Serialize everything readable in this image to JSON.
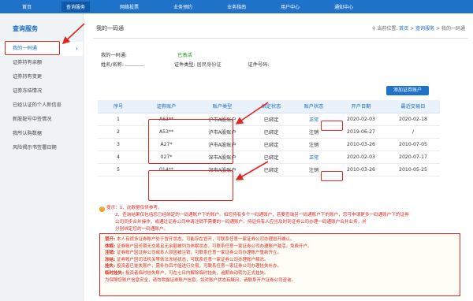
{
  "topnav": {
    "items": [
      "首页",
      "查询服务",
      "网络投票",
      "业务预约",
      "业务指南",
      "用户中心",
      "通知中心"
    ]
  },
  "sidebar": {
    "title": "查询服务",
    "items": [
      "我的一码通",
      "证券持有余额",
      "证券持有变更",
      "证券冻结情况",
      "已经认证的个人新信息",
      "新股配号中签情况",
      "我所认购数据",
      "风险揭示书签署日期"
    ],
    "chevron": "›"
  },
  "header": {
    "title": "我的一码通",
    "breadcrumb_prefix": "当前位置:",
    "breadcrumb": [
      "首页",
      "查询服务",
      "我的一码通"
    ]
  },
  "info": {
    "account_label": "我的一码通:",
    "status": "已激活",
    "name_label": "姓名/名称:",
    "id_type_label": "证件类型:",
    "id_type_value": "居民身份证",
    "id_no_label": "证件号码:"
  },
  "add_button": "添加证券账户",
  "table": {
    "headers": [
      "序号",
      "证券账户",
      "账户类型",
      "绑定状态",
      "账户状态",
      "开户日期",
      "最近交易日"
    ],
    "rows": [
      [
        "1",
        "A63**",
        "沪市A股账户",
        "已绑定",
        "正常",
        "2020-02-03",
        "2020-02-18"
      ],
      [
        "2",
        "A53**",
        "沪市A股账户",
        "已绑定",
        "注销",
        "2019-06-27",
        "/"
      ],
      [
        "3",
        "A27*",
        "沪市A股账户",
        "已绑定",
        "注销",
        "2010-03-26",
        "2010-07-05"
      ],
      [
        "4",
        "027*",
        "深市A股账户",
        "已绑定",
        "正常",
        "2020-02-03",
        "2020-07-17"
      ],
      [
        "5",
        "014**",
        "深市A股账户",
        "已绑定",
        "注销",
        "2010-03-26",
        "2010-05-25"
      ]
    ]
  },
  "tips": {
    "lines": [
      "提示：1、此数据仅供参考。",
      "2、查询结果仅包括您已经绑定的一码通账户下的账户。如您持有多个一码通账户，若要查询另一码通账户下的账户，您可申请更多一码通账户下的证券",
      "公司同步合并操作，或通过证券公司申请注销不需要的一码通账户。持证持有人应当及时到证券公司办理一码通账户合并业务，并",
      "分别绑定您的一码通账户。"
    ]
  },
  "states": {
    "lines": [
      [
        "冒开:",
        "本人有很多证券账户处于冒开状态，可能存在冒开，可联系任意一家证券公司办理冒开确认。"
      ],
      [
        "休眠:",
        "证券账户因长期无交易且无余额被列为休眠状态，可联系任意一家证券公司办理账户激活，免费开户。"
      ],
      [
        "注销:",
        "证券账户因证券公司或本人原因被注销，可联系任意一家证券公司办理账户重新开立。"
      ],
      [
        "冻结:",
        "证券账户因司法机关等依法冻结状态，可联系任意一家证券公司办理账户解冻。"
      ],
      [
        "挂失:",
        "投资者已挂失账户，需补办后才能进行交易，可联系任意一家证券公司办理挂失补办。"
      ],
      [
        "临时挂失:",
        "投资者临时挂失账户，可在七日内解除临时挂失，逾期自动转为正式挂失。"
      ],
      [
        "",
        "为保障您账户信息安全，请勿泄露证券账户信息。如对账户状态有疑问，请联系开户证券公司咨询。"
      ]
    ]
  }
}
